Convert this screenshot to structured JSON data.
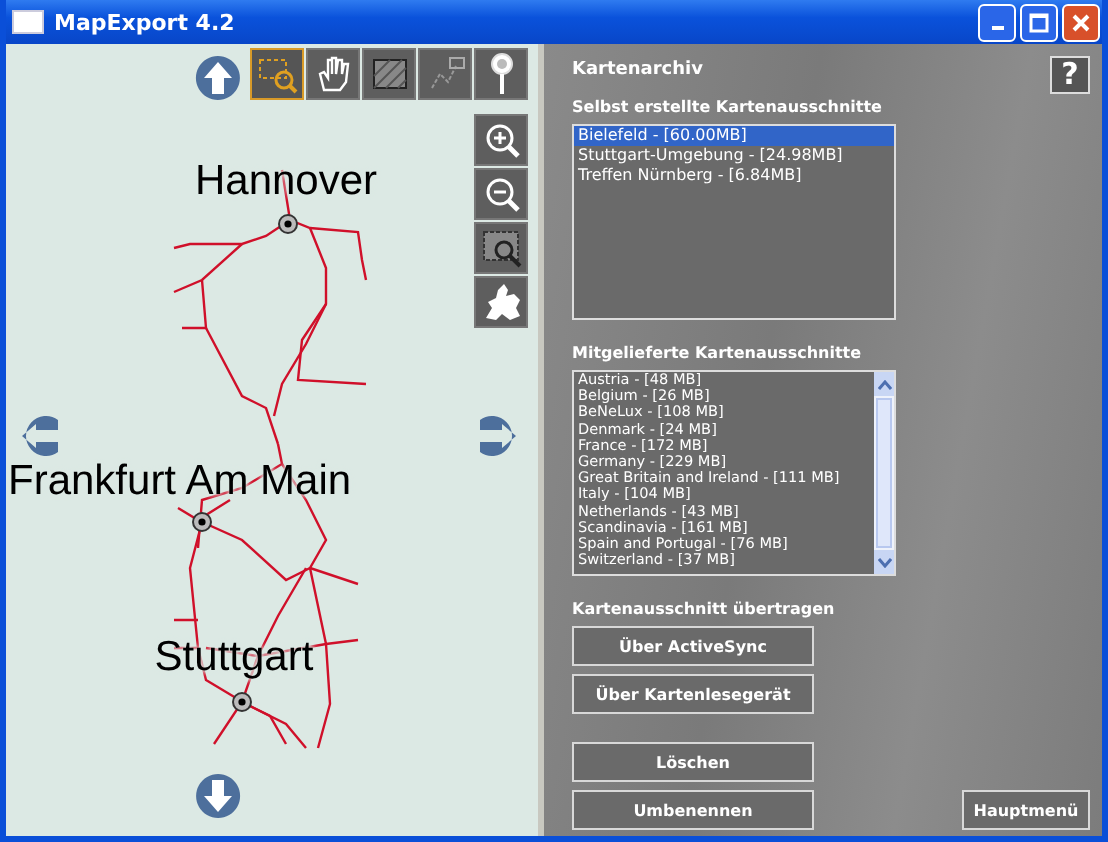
{
  "window": {
    "title": "MapExport 4.2"
  },
  "map": {
    "tools": [
      {
        "kind": "zoom-select",
        "selected": true
      },
      {
        "kind": "pan",
        "selected": false
      },
      {
        "kind": "area",
        "selected": false
      },
      {
        "kind": "route",
        "selected": false
      }
    ],
    "cities": [
      {
        "name": "Hannover"
      },
      {
        "name": "Frankfurt Am Main"
      },
      {
        "name": "Stuttgart"
      }
    ]
  },
  "panel": {
    "title": "Kartenarchiv",
    "help": "?",
    "own": {
      "label": "Selbst erstellte Kartenausschnitte",
      "items": [
        {
          "text": "Bielefeld - [60.00MB]",
          "selected": true
        },
        {
          "text": "Stuttgart-Umgebung - [24.98MB]",
          "selected": false
        },
        {
          "text": "Treffen Nürnberg - [6.84MB]",
          "selected": false
        }
      ]
    },
    "supplied": {
      "label": "Mitgelieferte Kartenausschnitte",
      "items": [
        {
          "text": "Austria - [48 MB]",
          "selected": false
        },
        {
          "text": "Belgium - [26 MB]",
          "selected": false
        },
        {
          "text": "BeNeLux - [108 MB]",
          "selected": false
        },
        {
          "text": "Denmark - [24 MB]",
          "selected": false
        },
        {
          "text": "France - [172 MB]",
          "selected": false
        },
        {
          "text": "Germany - [229 MB]",
          "selected": false
        },
        {
          "text": "Great Britain and Ireland - [111 MB]",
          "selected": false
        },
        {
          "text": "Italy - [104 MB]",
          "selected": false
        },
        {
          "text": "Netherlands - [43 MB]",
          "selected": false
        },
        {
          "text": "Scandinavia - [161 MB]",
          "selected": false
        },
        {
          "text": "Spain and Portugal - [76 MB]",
          "selected": false
        },
        {
          "text": "Switzerland - [37 MB]",
          "selected": false
        }
      ]
    },
    "transfer": {
      "label": "Kartenausschnitt übertragen",
      "buttons": [
        "Über ActiveSync",
        "Über Kartenlesegerät"
      ]
    },
    "actions": [
      "Löschen",
      "Umbenennen"
    ],
    "main_menu": "Hauptmenü"
  }
}
